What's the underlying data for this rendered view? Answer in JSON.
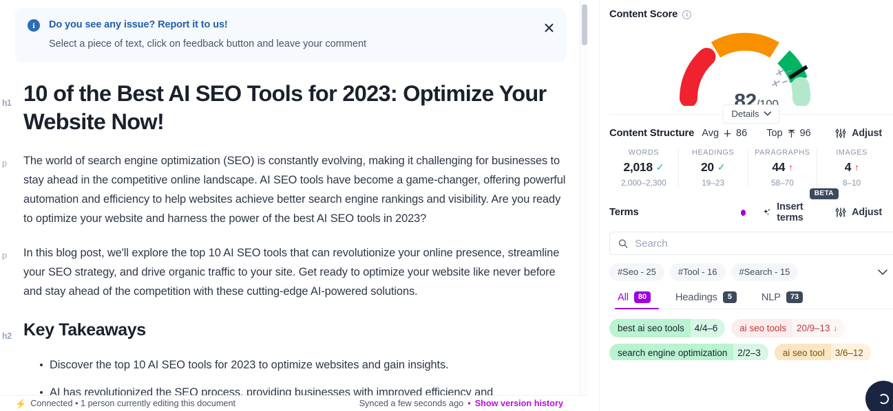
{
  "editor": {
    "banner": {
      "icon": "info-icon",
      "title": "Do you see any issue? Report it to us!",
      "subtitle": "Select a piece of text, click on feedback button and leave your comment",
      "close_icon": "close-icon"
    },
    "blocks": {
      "h1_tag": "h1",
      "h1": "10 of the Best AI SEO Tools for 2023: Optimize Your Website Now!",
      "p1_tag": "p",
      "p1": "The world of search engine optimization (SEO) is constantly evolving, making it challenging for businesses to stay ahead in the competitive online landscape. AI SEO tools have become a game-changer, offering powerful automation and efficiency to help websites achieve better search engine rankings and visibility. Are you ready to optimize your website and harness the power of the best AI SEO tools in 2023?",
      "p2_tag": "p",
      "p2": "In this blog post, we'll explore the top 10 AI SEO tools that can revolutionize your online presence, streamline your SEO strategy, and drive organic traffic to your site. Get ready to optimize your website like never before and stay ahead of the competition with these cutting-edge AI-powered solutions.",
      "h2_tag": "h2",
      "h2": "Key Takeaways",
      "bullets": [
        "Discover the top 10 AI SEO tools for 2023 to optimize websites and gain insights.",
        "AI has revolutionized the SEO process, providing businesses with improved efficiency and"
      ]
    },
    "footer": {
      "status_icon": "lightning-bolt-icon",
      "status": "Connected • 1 person currently editing this document",
      "synced": "Synced a few seconds ago",
      "separator": "•",
      "version_history": "Show version history"
    }
  },
  "sidebar": {
    "content_score": {
      "title": "Content Score",
      "info_icon": "info-circle-icon",
      "score": "82",
      "denominator": "/100",
      "avg_label": "Avg",
      "avg_icon": "divide-icon",
      "avg_value": "86",
      "top_label": "Top",
      "top_icon": "arrow-up-icon",
      "top_value": "96",
      "details_label": "Details",
      "details_chevron": "chevron-down-icon",
      "gauge": {
        "value": 82,
        "max": 100,
        "segments": [
          {
            "name": "red",
            "color": "#f0222e",
            "from": 0,
            "to": 25
          },
          {
            "name": "orange",
            "color": "#f99000",
            "from": 27,
            "to": 60
          },
          {
            "name": "green",
            "color": "#00b464",
            "from": 62,
            "to": 82
          },
          {
            "name": "light-green",
            "color": "#b3e8cc",
            "from": 82,
            "to": 100
          }
        ]
      }
    },
    "content_structure": {
      "title": "Content Structure",
      "adjust_label": "Adjust",
      "adjust_icon": "sliders-icon",
      "metrics": [
        {
          "label": "WORDS",
          "value": "2,018",
          "status": "ok",
          "status_icon": "check-icon",
          "range": "2,000–2,300"
        },
        {
          "label": "HEADINGS",
          "value": "20",
          "status": "ok",
          "status_icon": "check-icon",
          "range": "19–23"
        },
        {
          "label": "PARAGRAPHS",
          "value": "44",
          "status": "low",
          "status_icon": "arrow-up-icon",
          "range": "58–70"
        },
        {
          "label": "IMAGES",
          "value": "4",
          "status": "low",
          "status_icon": "arrow-up-icon",
          "range": "8–10"
        }
      ]
    },
    "terms": {
      "title": "Terms",
      "dot_color": "#9f00e0",
      "insert_icon": "sparkles-icon",
      "insert_label": "Insert terms",
      "beta_label": "BETA",
      "adjust_label": "Adjust",
      "adjust_icon": "sliders-icon",
      "search": {
        "icon": "search-icon",
        "placeholder": "Search",
        "value": ""
      },
      "chips": [
        "#Seo - 25",
        "#Tool - 16",
        "#Search - 15"
      ],
      "chips_chevron": "chevron-down-icon",
      "tabs": [
        {
          "label": "All",
          "badge": "80",
          "active": true
        },
        {
          "label": "Headings",
          "badge": "5",
          "active": false
        },
        {
          "label": "NLP",
          "badge": "73",
          "active": false
        }
      ],
      "items": [
        {
          "name": "best ai seo tools",
          "count": "4/4–6",
          "state": "green",
          "trend": ""
        },
        {
          "name": "ai seo tools",
          "count": "20/9–13",
          "state": "red",
          "trend": "↓"
        },
        {
          "name": "search engine optimization",
          "count": "2/2–3",
          "state": "green",
          "trend": ""
        },
        {
          "name": "ai seo tool",
          "count": "3/6–12",
          "state": "orange",
          "trend": ""
        }
      ]
    },
    "fab": {
      "icon": "assistant-icon"
    }
  }
}
